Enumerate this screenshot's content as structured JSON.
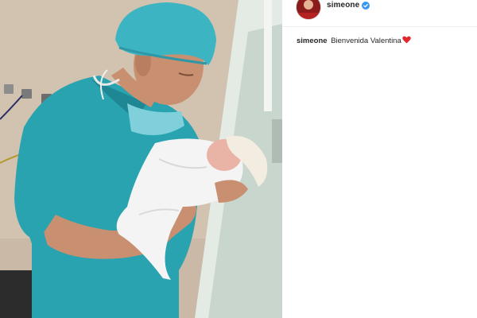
{
  "post": {
    "username": "simeone",
    "verified_icon": "verified-badge-icon",
    "caption": {
      "username": "simeone",
      "text": "Bienvenida Valentina",
      "emoji": "red-heart-icon"
    }
  },
  "colors": {
    "verified": "#3897f0",
    "heart": "#e0282e",
    "text": "#262626",
    "scrubs": "#2aa3b0"
  }
}
